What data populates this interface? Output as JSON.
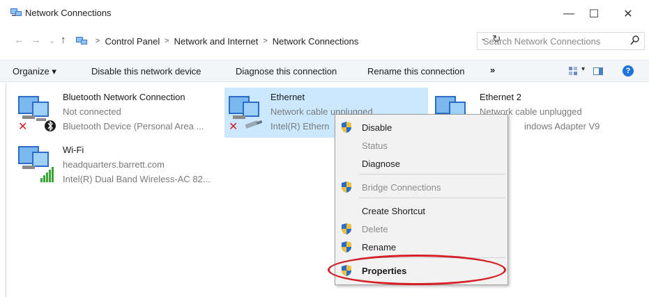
{
  "window": {
    "title": "Network Connections",
    "minimize_glyph": "—",
    "maximize_glyph": "☐",
    "close_glyph": "✕"
  },
  "addressbar": {
    "back_glyph": "←",
    "forward_glyph": "→",
    "recent_glyph": "⌄",
    "up_glyph": "↑",
    "separator": ">",
    "breadcrumbs": [
      "Control Panel",
      "Network and Internet",
      "Network Connections"
    ],
    "dropdown_glyph": "⌄",
    "refresh_glyph": "↻",
    "search_placeholder": "Search Network Connections"
  },
  "toolbar": {
    "organize": "Organize ▾",
    "disable": "Disable this network device",
    "diagnose": "Diagnose this connection",
    "rename": "Rename this connection",
    "more": "»",
    "view_caret": "▾",
    "help": "?"
  },
  "connections": [
    {
      "name": "Bluetooth Network Connection",
      "status": "Not connected",
      "device": "Bluetooth Device (Personal Area ...",
      "badge": "bluetooth-x",
      "selected": false
    },
    {
      "name": "Ethernet",
      "status": "Network cable unplugged",
      "device": "Intel(R) Ethern",
      "badge": "cable-x",
      "selected": true
    },
    {
      "name": "Ethernet 2",
      "status": "Network cable unplugged",
      "device": "indows Adapter V9",
      "badge": "none",
      "selected": false
    },
    {
      "name": "Wi-Fi",
      "status": "headquarters.barrett.com",
      "device": "Intel(R) Dual Band Wireless-AC 82...",
      "badge": "wifi-bars",
      "selected": false
    }
  ],
  "context_menu": {
    "items": [
      {
        "label": "Disable",
        "shield": true,
        "enabled": true,
        "bold": false
      },
      {
        "label": "Status",
        "shield": false,
        "enabled": false,
        "bold": false
      },
      {
        "label": "Diagnose",
        "shield": false,
        "enabled": true,
        "bold": false
      },
      {
        "label": "Bridge Connections",
        "shield": true,
        "enabled": false,
        "bold": false
      },
      {
        "label": "Create Shortcut",
        "shield": false,
        "enabled": true,
        "bold": false
      },
      {
        "label": "Delete",
        "shield": true,
        "enabled": false,
        "bold": false
      },
      {
        "label": "Rename",
        "shield": true,
        "enabled": true,
        "bold": false
      },
      {
        "label": "Properties",
        "shield": true,
        "enabled": true,
        "bold": true
      }
    ]
  },
  "colors": {
    "selection": "#cce8ff",
    "highlight_oval": "#d42027",
    "menu_bg": "#f2f2f2",
    "shield_blue": "#2a6cc8",
    "shield_yellow": "#f0c23a",
    "error_red": "#d0212a"
  },
  "icons": {
    "title": "network-connections-icon",
    "search": "search-icon",
    "view": "change-view-icon",
    "pane": "preview-pane-icon",
    "help": "help-icon",
    "shield": "uac-shield-icon"
  }
}
